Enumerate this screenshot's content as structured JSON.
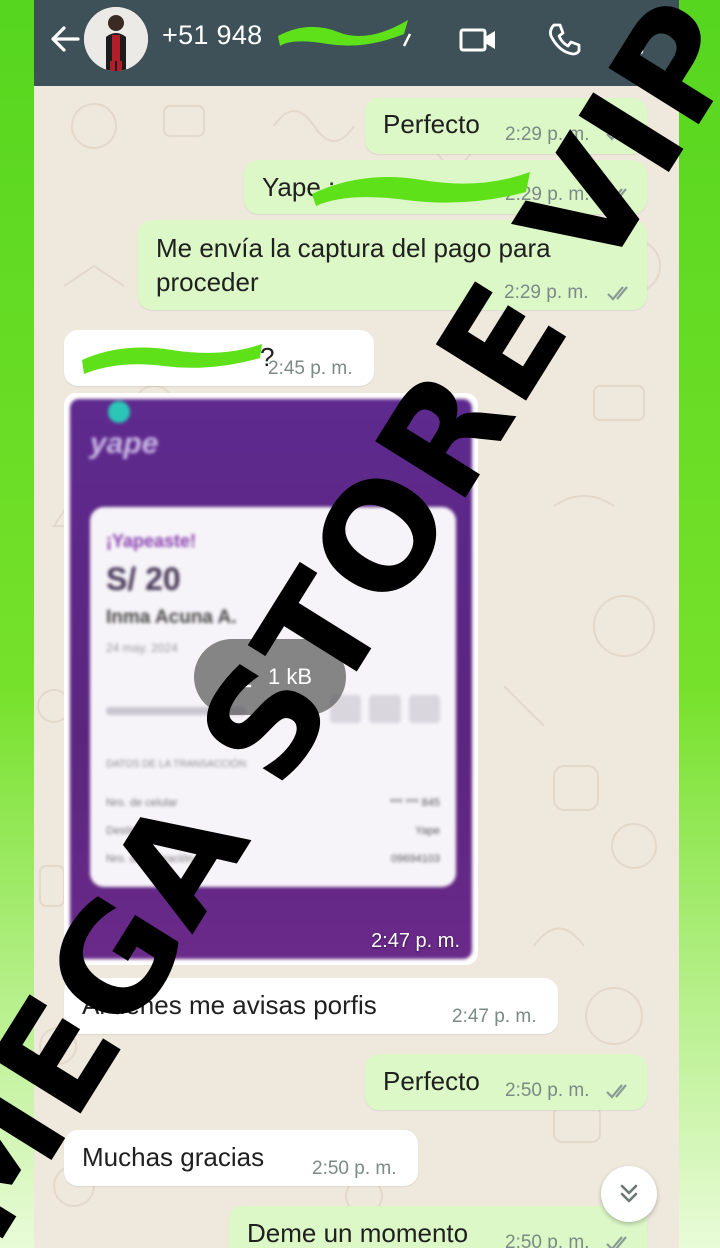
{
  "header": {
    "contact_name": "+51 948",
    "back_icon": "arrow-left-icon",
    "video_icon": "video-camera-icon",
    "call_icon": "phone-icon",
    "menu_icon": "more-vertical-icon"
  },
  "messages": [
    {
      "direction": "out",
      "text": "Perfecto",
      "time": "2:29 p. m.",
      "status": "read"
    },
    {
      "direction": "out",
      "text": "Yape :",
      "time": "2:29 p. m.",
      "status": "read"
    },
    {
      "direction": "out",
      "text_line1": "Me envía la captura del pago para",
      "text_line2": "proceder",
      "time": "2:29 p. m.",
      "status": "read"
    },
    {
      "direction": "in",
      "text": "?",
      "time": "2:45 p. m."
    },
    {
      "direction": "in",
      "type": "image",
      "time": "2:47 p. m.",
      "download_label": "1 kB"
    },
    {
      "direction": "in",
      "text": "Al tienes me avisas porfis",
      "time": "2:47 p. m."
    },
    {
      "direction": "out",
      "text": "Perfecto",
      "time": "2:50 p. m.",
      "status": "read"
    },
    {
      "direction": "in",
      "text": "Muchas gracias",
      "time": "2:50 p. m."
    },
    {
      "direction": "out",
      "text": "Deme un momento",
      "time": "2:50 p. m.",
      "status": "read"
    }
  ],
  "receipt_preview": {
    "brand": "yape",
    "heading": "¡Yapeaste!",
    "amount": "S/ 20",
    "recipient": "Inma Acuna A.",
    "date": "24 may. 2024",
    "section": "DATOS DE LA TRANSACCIÓN",
    "rows": [
      {
        "label": "Nro. de celular",
        "value": "*** *** 845"
      },
      {
        "label": "Destino",
        "value": "Yape"
      },
      {
        "label": "Nro. de operación",
        "value": "09694103"
      }
    ]
  },
  "watermark": "MEGA STORE VIP",
  "colors": {
    "header_bg": "#3e5158",
    "outgoing_bubble": "#dcf8c6",
    "incoming_bubble": "#ffffff",
    "chat_bg": "#efe8dc",
    "read_ticks": "#8a9a95",
    "redaction": "#5fe11a",
    "frame": "#56d61f"
  },
  "scroll_button_icon": "double-chevron-down-icon"
}
